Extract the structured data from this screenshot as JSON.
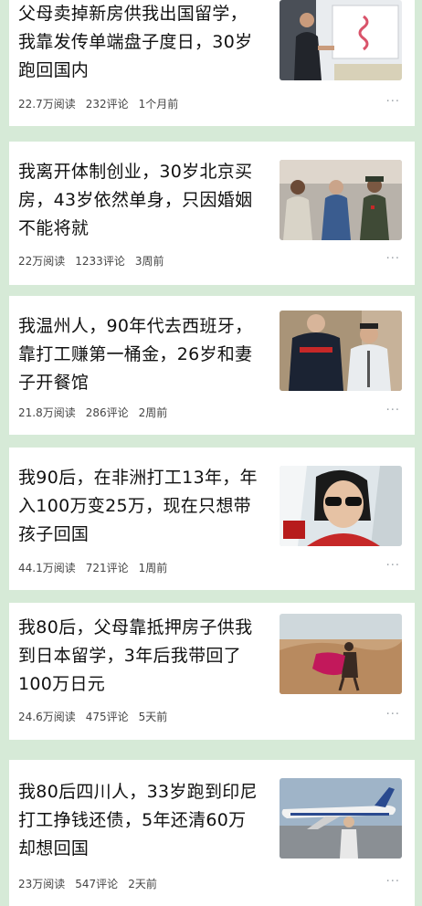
{
  "articles": [
    {
      "title": "父母卖掉新房供我出国留学，我靠发传单端盘子度日，30岁跑回国内",
      "reads": "22.7万阅读",
      "comments": "232评论",
      "time": "1个月前",
      "more": "···",
      "image": "man-presenting-whiteboard"
    },
    {
      "title": "我离开体制创业，30岁北京买房，43岁依然单身，只因婚姻不能将就",
      "reads": "22万阅读",
      "comments": "1233评论",
      "time": "3周前",
      "more": "···",
      "image": "group-photo-uniforms"
    },
    {
      "title": "我温州人，90年代去西班牙，靠打工赚第一桶金，26岁和妻子开餐馆",
      "reads": "21.8万阅读",
      "comments": "286评论",
      "time": "2周前",
      "more": "···",
      "image": "man-with-police-officer"
    },
    {
      "title": "我90后，在非洲打工13年，年入100万变25万，现在只想带孩子回国",
      "reads": "44.1万阅读",
      "comments": "721评论",
      "time": "1周前",
      "more": "···",
      "image": "woman-sunglasses-selfie"
    },
    {
      "title": "我80后，父母靠抵押房子供我到日本留学，3年后我带回了100万日元",
      "reads": "24.6万阅读",
      "comments": "475评论",
      "time": "5天前",
      "more": "···",
      "image": "woman-desert-scarf"
    },
    {
      "title": "我80后四川人，33岁跑到印尼打工挣钱还债，5年还清60万却想回国",
      "reads": "23万阅读",
      "comments": "547评论",
      "time": "2天前",
      "more": "···",
      "image": "man-airplane-runway"
    }
  ]
}
